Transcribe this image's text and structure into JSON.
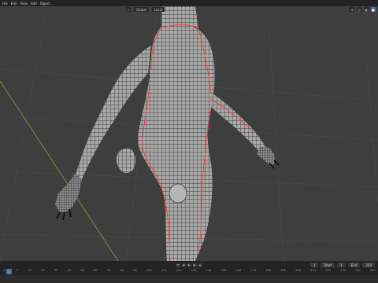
{
  "menu": [
    "File",
    "Edit",
    "View",
    "Add",
    "Object"
  ],
  "viewport_header": {
    "mode": "Global",
    "view": "Local"
  },
  "timeline": {
    "current_frame": "1",
    "start_label": "Start",
    "start": "1",
    "end_label": "End",
    "end": "250",
    "ruler": [
      "-10",
      "0",
      "10",
      "20",
      "30",
      "40",
      "50",
      "60",
      "70",
      "80",
      "90",
      "100",
      "110",
      "120",
      "130",
      "140",
      "150",
      "160",
      "170",
      "180",
      "190",
      "200",
      "210",
      "220",
      "230",
      "240",
      "250"
    ]
  },
  "colors": {
    "seam": "#ff3b3b",
    "accent": "#4772b3",
    "mesh": "#9a9a9a",
    "wire": "#1e1e1e"
  },
  "icons": [
    "cursor-icon",
    "grid-icon",
    "shading-solid-icon",
    "overlay-icon",
    "gizmo-icon",
    "play-icon",
    "jump-end-icon",
    "jump-start-icon"
  ]
}
